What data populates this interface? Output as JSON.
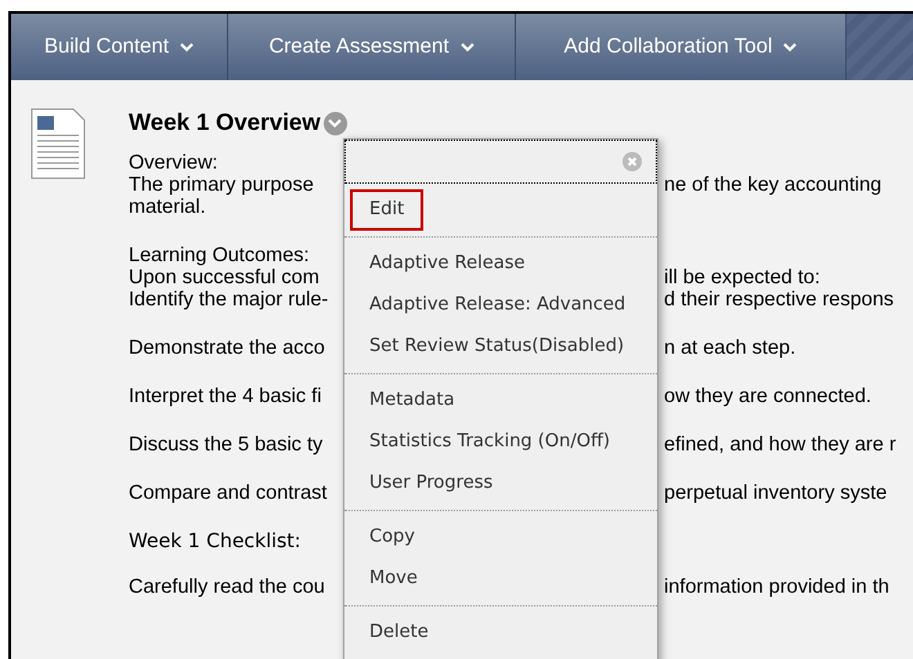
{
  "nav_tabs": [
    {
      "label": "Build Content"
    },
    {
      "label": "Create Assessment"
    },
    {
      "label": "Add Collaboration Tool"
    }
  ],
  "item": {
    "title": "Week 1 Overview",
    "paragraphs": [
      {
        "kind": "text",
        "lines": [
          {
            "left": "Overview:"
          },
          {
            "left": "The primary purpose",
            "right": "ne of the key accounting"
          },
          {
            "left": "material."
          }
        ]
      },
      {
        "kind": "text",
        "lines": [
          {
            "left": "Learning Outcomes:"
          },
          {
            "left": "Upon successful com",
            "right": "ill be expected to:"
          },
          {
            "left": "Identify the major rule-",
            "right": "d their respective respons"
          }
        ]
      },
      {
        "kind": "text",
        "lines": [
          {
            "left": "Demonstrate the acco",
            "right": "n at each step."
          }
        ]
      },
      {
        "kind": "text",
        "lines": [
          {
            "left": "Interpret the 4 basic fi",
            "right": "ow they are connected."
          }
        ]
      },
      {
        "kind": "text",
        "lines": [
          {
            "left": "Discuss the 5 basic ty",
            "right": "efined, and how they are r"
          }
        ]
      },
      {
        "kind": "text",
        "lines": [
          {
            "left": "Compare and contrast",
            "right": "perpetual inventory syste"
          }
        ]
      },
      {
        "kind": "heading",
        "lines": [
          {
            "left": "Week 1 Checklist:"
          }
        ]
      },
      {
        "kind": "text",
        "lines": [
          {
            "left": "Carefully read the cou",
            "right": "information provided in th"
          }
        ]
      }
    ]
  },
  "context_menu": {
    "groups": [
      [
        {
          "label": "Edit",
          "selected": true
        }
      ],
      [
        {
          "label": "Adaptive Release",
          "selected": false
        },
        {
          "label": "Adaptive Release: Advanced",
          "selected": false
        },
        {
          "label": "Set Review Status(Disabled)",
          "selected": false
        }
      ],
      [
        {
          "label": "Metadata",
          "selected": false
        },
        {
          "label": "Statistics Tracking (On/Off)",
          "selected": false
        },
        {
          "label": "User Progress",
          "selected": false
        }
      ],
      [
        {
          "label": "Copy",
          "selected": false
        },
        {
          "label": "Move",
          "selected": false
        }
      ],
      [
        {
          "label": "Delete",
          "selected": false
        }
      ]
    ]
  }
}
